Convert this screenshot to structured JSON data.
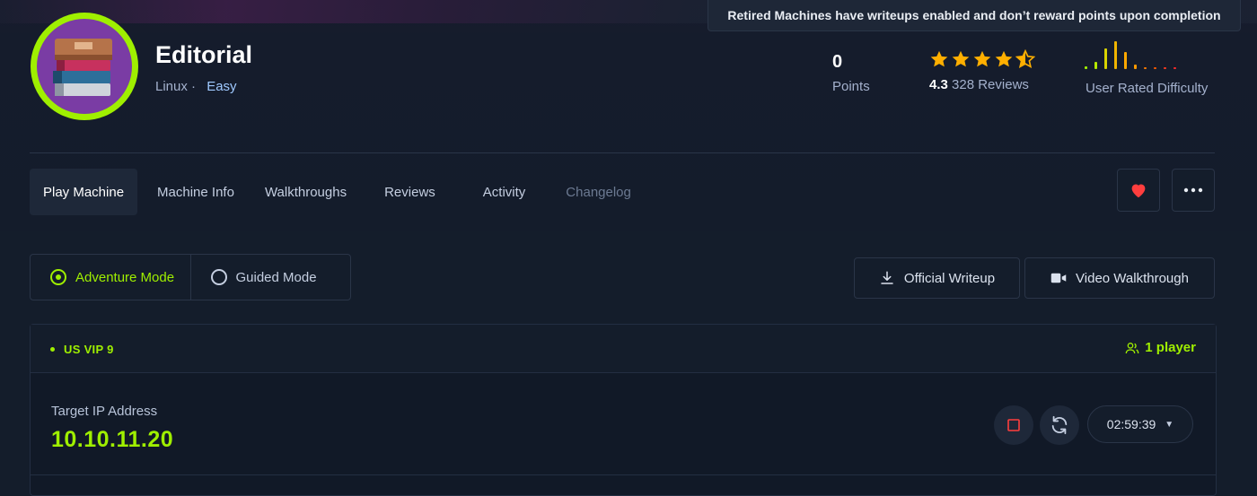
{
  "banner": {
    "text": "Retired Machines have writeups enabled and don’t reward points upon completion"
  },
  "machine": {
    "name": "Editorial",
    "os": "Linux",
    "separator": "·",
    "difficulty": "Easy"
  },
  "stats": {
    "points_value": "0",
    "points_label": "Points",
    "rating_value": "4.3",
    "rating_reviews": "328 Reviews",
    "star_rating": 4.3,
    "difficulty_label": "User Rated Difficulty"
  },
  "tabs": [
    {
      "label": "Play Machine"
    },
    {
      "label": "Machine Info"
    },
    {
      "label": "Walkthroughs"
    },
    {
      "label": "Reviews"
    },
    {
      "label": "Activity"
    },
    {
      "label": "Changelog"
    }
  ],
  "icons": {
    "favorite": "heart-icon",
    "more": "more-icon",
    "download": "download-icon",
    "video": "video-icon",
    "players": "users-icon",
    "stop": "stop-icon",
    "reset": "refresh-icon"
  },
  "modes": {
    "adventure": "Adventure Mode",
    "guided": "Guided Mode"
  },
  "actions": {
    "writeup": "Official Writeup",
    "video": "Video Walkthrough"
  },
  "instance": {
    "server": "US VIP 9",
    "players": "1 player",
    "ip_label": "Target IP Address",
    "ip": "10.10.11.20",
    "timer": "02:59:39"
  },
  "colors": {
    "accent": "#9fef00",
    "background": "#141d2b",
    "star": "#ffaf00",
    "heart": "#ff3e3e"
  }
}
